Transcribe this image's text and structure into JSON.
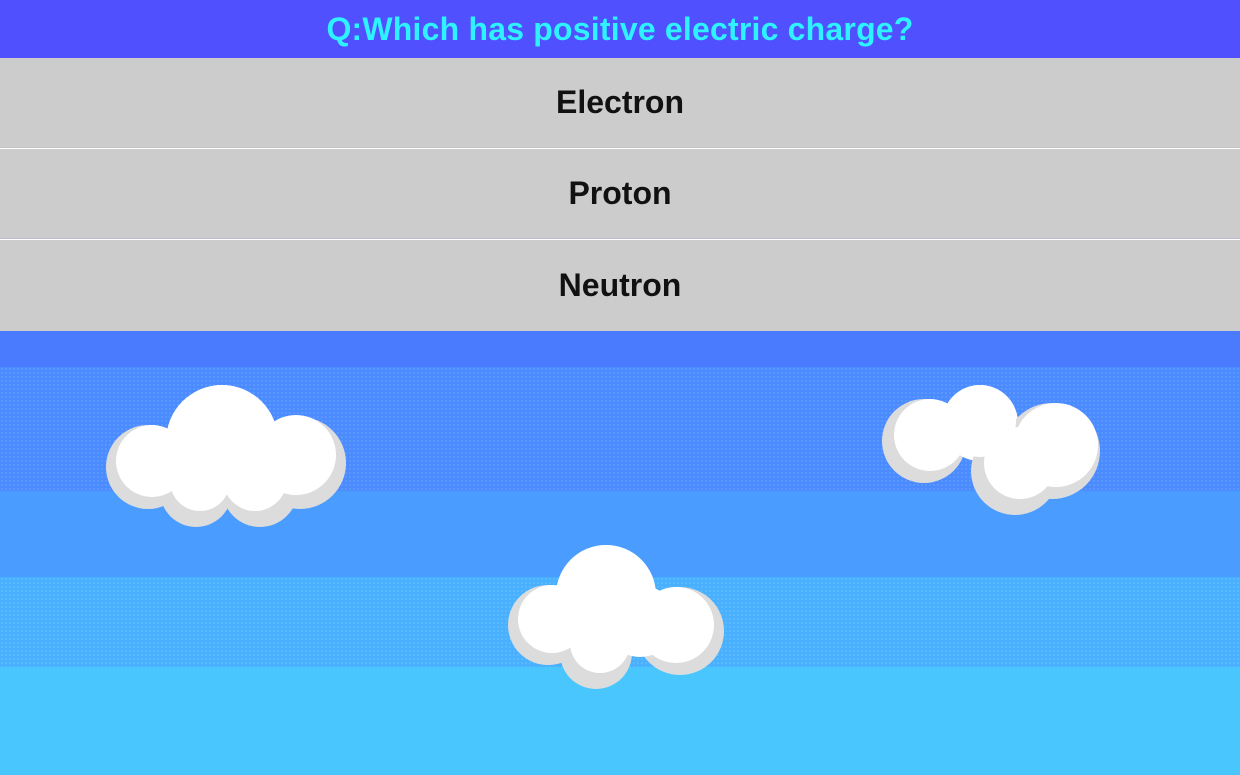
{
  "question": {
    "text": "Q:Which has positive electric charge?"
  },
  "answers": [
    {
      "label": "Electron"
    },
    {
      "label": "Proton"
    },
    {
      "label": "Neutron"
    }
  ],
  "scene": {
    "background": "sky",
    "clouds": 3
  },
  "colors": {
    "question_bar": "#5050ff",
    "question_text": "#2ef2ff",
    "answer_bg": "#cccccc",
    "answer_text": "#111111",
    "sky_top": "#4a7bff",
    "sky_upper": "#4a8cff",
    "sky_mid": "#4a9cff",
    "sky_lower": "#48b6ff",
    "sky_bottom": "#4ac6ff",
    "cloud": "#ffffff",
    "cloud_shade": "#dcdcdc"
  }
}
